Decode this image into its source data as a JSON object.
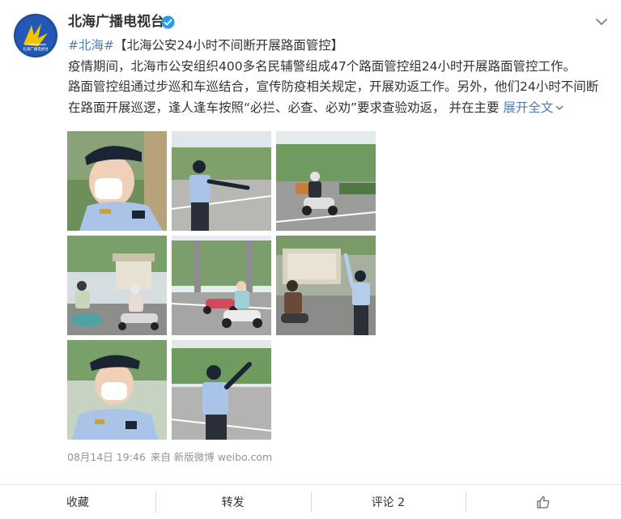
{
  "post": {
    "author": "北海广播电视台",
    "avatar_icon": "beihai-tv-logo",
    "verified_icon": "verified-badge-icon",
    "menu_icon": "chevron-down-icon",
    "topic": "#北海#",
    "title": "【北海公安24小时不间断开展路面管控】",
    "line1": "疫情期间，北海市公安组织400多名民辅警组成47个路面管控组24小时开展路面管控工作。",
    "line2": "路面管控组通过步巡和车巡结合，宣传防疫相关规定，开展劝返工作。另外，他们24小时不间断",
    "line3": "在路面开展巡逻，逢人逢车按照“必拦、必查、必劝”要求查验劝返， 并在主要 ",
    "expand": "展开全文",
    "expand_icon": "chevron-down-icon",
    "time": "08月14日 19:46",
    "source": "来自 新版微博 weibo.com",
    "images": [
      "police-officer-portrait",
      "officer-directing-traffic",
      "scooter-rider-on-road",
      "riders-at-bus-stop",
      "scooters-at-intersection",
      "officer-waving-at-rider",
      "officer-closeup",
      "officer-raising-arm"
    ]
  },
  "actions": {
    "favorite": "收藏",
    "repost": "转发",
    "comment": "评论 2",
    "like_icon": "thumbs-up-icon"
  },
  "colors": {
    "link": "#507daf",
    "text": "#333333",
    "meta": "#939393",
    "verified": "#2f9be8"
  }
}
